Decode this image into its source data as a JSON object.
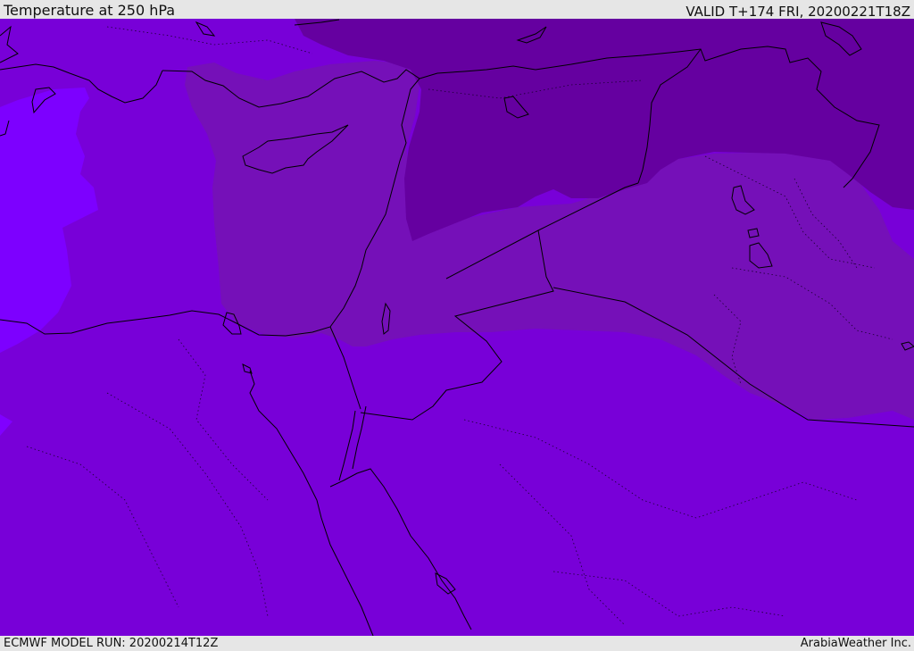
{
  "header": {
    "title": "Temperature at 250 hPa",
    "valid_time": "VALID T+174 FRI, 20200221T18Z"
  },
  "footer": {
    "model_run": "ECMWF MODEL RUN: 20200214T12Z",
    "credit": "ArabiaWeather Inc."
  },
  "map": {
    "field": "temperature-250hPa",
    "colors": {
      "warmest_band": "#7d00ff",
      "mid_band": "#7800d8",
      "cool_band": "#7510b8",
      "cold_band": "#6500a0",
      "coastline": "#000000"
    }
  }
}
